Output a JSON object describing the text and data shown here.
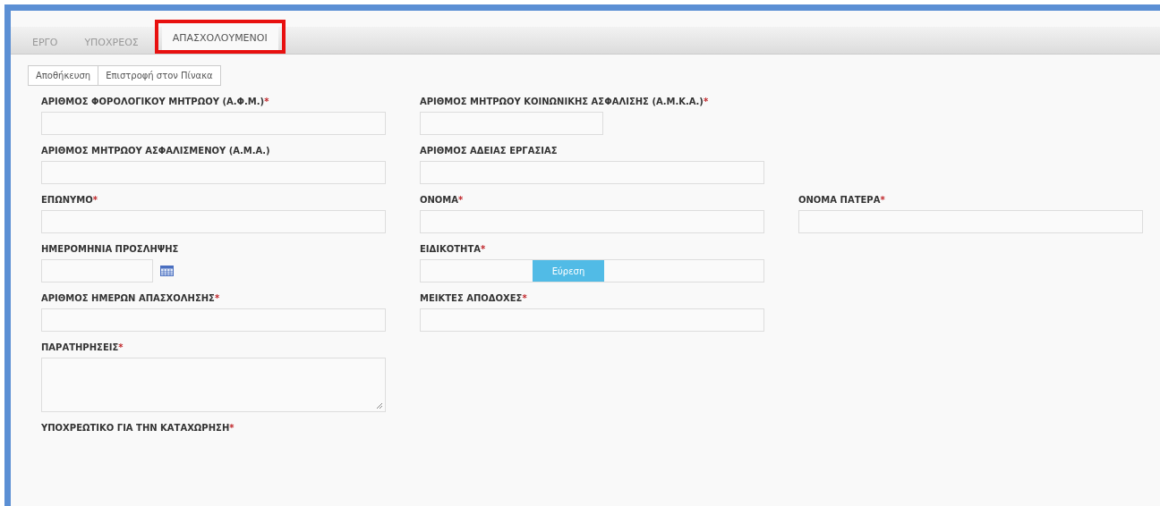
{
  "tabs": [
    {
      "label": "ΕΡΓΟ",
      "selected": false,
      "highlighted": false
    },
    {
      "label": "ΥΠΟΧΡΕΟΣ",
      "selected": false,
      "highlighted": false
    },
    {
      "label": "ΑΠΑΣΧΟΛΟΥΜΕΝΟΙ",
      "selected": true,
      "highlighted": true
    }
  ],
  "buttons": [
    "Αποθήκευση",
    "Επιστροφή στον Πίνακα"
  ],
  "rows": [
    [
      {
        "label": "ΑΡΙΘΜΟΣ ΦΟΡΟΛΟΓΙΚΟΥ ΜΗΤΡΩΟΥ (Α.Φ.Μ.)",
        "required_mark": "*",
        "kind": "text"
      },
      {
        "label": "ΑΡΙΘΜΟΣ ΜΗΤΡΩΟΥ ΚΟΙΝΩΝΙΚΗΣ ΑΣΦΑΛΙΣΗΣ (Α.Μ.Κ.Α.)",
        "required_mark": "*",
        "kind": "short"
      }
    ],
    [
      {
        "label": "ΑΡΙΘΜΟΣ ΜΗΤΡΩΟΥ ΑΣΦΑΛΙΣΜΕΝΟΥ (Α.Μ.Α.)",
        "kind": "text"
      },
      {
        "label": "ΑΡΙΘΜΟΣ ΑΔΕΙΑΣ ΕΡΓΑΣΙΑΣ",
        "kind": "text"
      }
    ],
    [
      {
        "label": "ΕΠΩΝΥΜΟ",
        "required_mark": "*",
        "kind": "text"
      },
      {
        "label": "ΟΝΟΜΑ",
        "required_mark": "*",
        "kind": "text"
      },
      {
        "label": "ΟΝΟΜΑ ΠΑΤΕΡΑ",
        "required_mark": "*",
        "kind": "text"
      }
    ],
    [
      {
        "label": "ΗΜΕΡΟΜΗΝΙΑ ΠΡΟΣΛΗΨΗΣ",
        "kind": "date"
      },
      {
        "label": "ΕΙΔΙΚΟΤΗΤΑ",
        "required_mark": "*",
        "kind": "lookup",
        "button": "Εύρεση"
      }
    ],
    [
      {
        "label": "ΑΡΙΘΜΟΣ ΗΜΕΡΩΝ ΑΠΑΣΧΟΛΗΣΗΣ",
        "required_mark": "*",
        "kind": "text"
      },
      {
        "label": "ΜΕΙΚΤΕΣ ΑΠΟΔΟΧΕΣ",
        "required_mark": "*",
        "kind": "text"
      }
    ],
    [
      {
        "label": "ΠΑΡΑΤΗΡΗΣΕΙΣ",
        "required_mark": "*",
        "kind": "textarea"
      }
    ],
    [
      {
        "label": "ΥΠΟΧΡΕΩΤΙΚΟ ΓΙΑ ΤΗΝ ΚΑΤΑΧΩΡΗΣΗ",
        "required_mark": "*",
        "kind": "none"
      }
    ]
  ]
}
